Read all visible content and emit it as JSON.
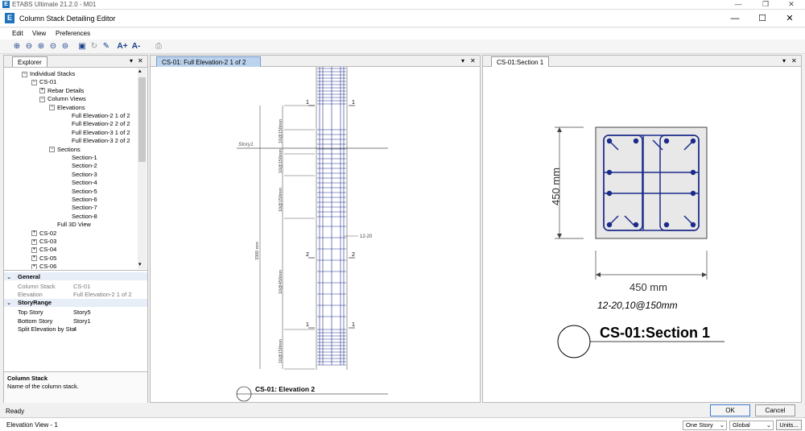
{
  "outer": {
    "title": "ETABS Ultimate 21.2.0 - M01",
    "logo": "E"
  },
  "window": {
    "title": "Column Stack Detailing Editor",
    "logo": "E",
    "min": "—",
    "max": "☐",
    "close": "✕"
  },
  "menu": [
    "Edit",
    "View",
    "Preferences"
  ],
  "toolbar_icons": [
    "zoom-in-icon",
    "zoom-out-icon",
    "zoom-window-icon",
    "zoom-previous-icon",
    "zoom-next-icon",
    "zoom-fit-icon",
    "refresh-icon",
    "pan-icon",
    "edit-icon",
    "font-increase-icon",
    "font-decrease-icon",
    "print-icon"
  ],
  "explorer": {
    "tab": "Explorer",
    "tree": [
      {
        "label": "Individual Stacks",
        "exp": "−"
      },
      {
        "label": "CS-01",
        "exp": "−"
      },
      {
        "label": "Rebar Details",
        "exp": "+"
      },
      {
        "label": "Column Views",
        "exp": "−"
      },
      {
        "label": "Elevations",
        "exp": "−"
      },
      {
        "label": "Full Elevation-2 1 of 2",
        "exp": ""
      },
      {
        "label": "Full Elevation-2 2 of 2",
        "exp": ""
      },
      {
        "label": "Full Elevation-3 1 of 2",
        "exp": ""
      },
      {
        "label": "Full Elevation-3 2 of 2",
        "exp": ""
      },
      {
        "label": "Sections",
        "exp": "−"
      },
      {
        "label": "Section-1",
        "exp": ""
      },
      {
        "label": "Section-2",
        "exp": ""
      },
      {
        "label": "Section-3",
        "exp": ""
      },
      {
        "label": "Section-4",
        "exp": ""
      },
      {
        "label": "Section-5",
        "exp": ""
      },
      {
        "label": "Section-6",
        "exp": ""
      },
      {
        "label": "Section-7",
        "exp": ""
      },
      {
        "label": "Section-8",
        "exp": ""
      },
      {
        "label": "Full 3D View",
        "exp": ""
      },
      {
        "label": "CS-02",
        "exp": "+"
      },
      {
        "label": "CS-03",
        "exp": "+"
      },
      {
        "label": "CS-04",
        "exp": "+"
      },
      {
        "label": "CS-05",
        "exp": "+"
      },
      {
        "label": "CS-06",
        "exp": "+"
      }
    ]
  },
  "props": {
    "general_header": "General",
    "column_stack_label": "Column Stack",
    "column_stack_value": "CS-01",
    "elevation_label": "Elevation",
    "elevation_value": "Full Elevation-2 1 of 2",
    "story_header": "StoryRange",
    "top_story_label": "Top Story",
    "top_story_value": "Story5",
    "bottom_story_label": "Bottom Story",
    "bottom_story_value": "Story1",
    "split_label": "Split Elevation by Sto",
    "split_value": "4"
  },
  "help": {
    "title": "Column Stack",
    "desc": "Name of the column stack."
  },
  "elevation_panel": {
    "tab": "CS-01: Full Elevation-2 1 of 2",
    "story_label": "Story1",
    "spacing_top": "10@150mm",
    "spacing_mid1": "10@150mm",
    "spacing_mid2": "10@150mm",
    "spacing_mid3": "10@450mm",
    "spacing_bot": "10@150mm",
    "height_dim": "3300 mm",
    "rebar_callout": "12-20",
    "sec1": "1",
    "sec2": "2",
    "caption": "CS-01: Elevation 2"
  },
  "section_panel": {
    "tab": "CS-01:Section 1",
    "dim_vertical": "450 mm",
    "dim_horizontal": "450 mm",
    "rebar_note": "12-20,10@150mm",
    "caption": "CS-01:Section 1"
  },
  "buttons": {
    "ok": "OK",
    "cancel": "Cancel"
  },
  "status": {
    "ready": "Ready",
    "view": "Elevation View - 1",
    "story_mode": "One Story",
    "coord": "Global",
    "units": "Units..."
  }
}
